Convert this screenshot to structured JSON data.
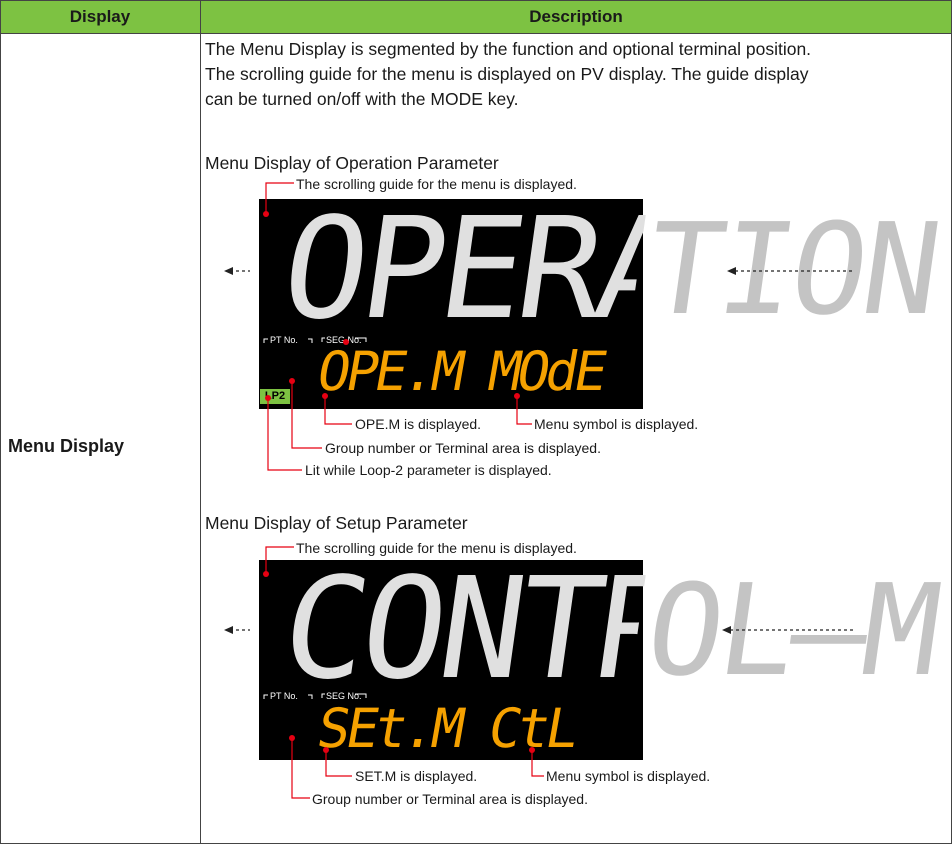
{
  "table": {
    "headers": {
      "display": "Display",
      "description": "Description"
    },
    "row": {
      "display_label": "Menu Display",
      "paragraph_lines": [
        "The Menu Display is segmented by the function and optional terminal position.",
        "The scrolling guide for the menu is displayed on PV display. The guide display",
        "can be turned on/off with the MODE key."
      ]
    }
  },
  "operation_section": {
    "title": "Menu Display of Operation Parameter",
    "pv_text": "OPERA",
    "pv_scroll_text": "TION",
    "sv_text": "OPE.M MOdE",
    "pt_no_label": "PT No.",
    "seg_no_label": "SEG No.",
    "lp2_label": "LP2",
    "callouts": {
      "scrolling_guide": "The scrolling guide for the menu is displayed.",
      "ope_m": "OPE.M is displayed.",
      "menu_symbol": "Menu symbol is displayed.",
      "group_number": "Group number or Terminal area is displayed.",
      "loop2": "Lit while Loop-2 parameter is displayed."
    }
  },
  "setup_section": {
    "title": "Menu Display of Setup Parameter",
    "pv_text": "CONTR",
    "pv_scroll_text": "OL–M",
    "sv_text": "SEt.M CtL",
    "pt_no_label": "PT No.",
    "seg_no_label": "SEG No.",
    "callouts": {
      "scrolling_guide": "The scrolling guide for the menu is displayed.",
      "set_m": "SET.M is displayed.",
      "menu_symbol": "Menu symbol is displayed.",
      "group_number": "Group number or Terminal area is displayed."
    }
  },
  "colors": {
    "header_green": "#7dc242",
    "lcd_background": "#000000",
    "pv_segment": "#e0e0e0",
    "pv_scroll_segment": "#c4c4c4",
    "sv_segment": "#f5a100",
    "lp2_badge": "#7dc242",
    "callout_red": "#e60012",
    "border": "#444444"
  }
}
